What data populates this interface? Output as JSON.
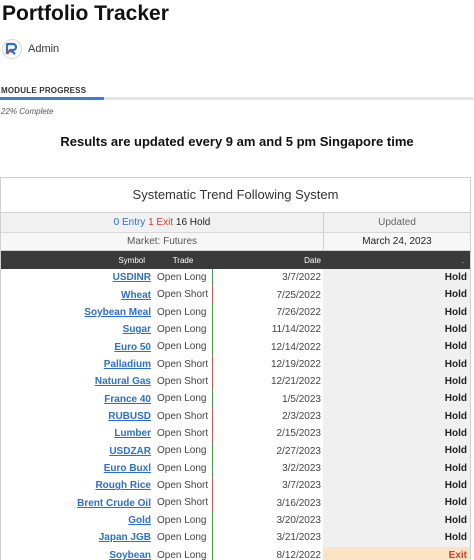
{
  "page": {
    "title": "Portfolio Tracker",
    "author": "Admin",
    "progress_label": "MODULE PROGRESS",
    "progress_percent": 22,
    "progress_text": "22% Complete",
    "headline": "Results are updated every 9 am and 5 pm Singapore time"
  },
  "card": {
    "title": "Systematic Trend Following System",
    "counts": {
      "entry_num": "0",
      "entry_label": " Entry ",
      "exit_num": "1",
      "exit_label": " Exit ",
      "hold": " 16 Hold"
    },
    "updated_label": "Updated",
    "market": "Market: Futures",
    "updated_date": "March 24, 2023"
  },
  "table": {
    "headers": {
      "symbol": "Symbol",
      "trade": "Trade",
      "date": "Date",
      "status": "."
    },
    "rows": [
      {
        "symbol": "USDINR",
        "trade": "Open Long",
        "date": "3/7/2022",
        "status": "Hold"
      },
      {
        "symbol": "Wheat",
        "trade": "Open Short",
        "date": "7/25/2022",
        "status": "Hold"
      },
      {
        "symbol": "Soybean Meal",
        "trade": "Open Long",
        "date": "7/26/2022",
        "status": "Hold"
      },
      {
        "symbol": "Sugar",
        "trade": "Open Long",
        "date": "11/14/2022",
        "status": "Hold"
      },
      {
        "symbol": "Euro 50",
        "trade": "Open Long",
        "date": "12/14/2022",
        "status": "Hold"
      },
      {
        "symbol": "Palladium",
        "trade": "Open Short",
        "date": "12/19/2022",
        "status": "Hold"
      },
      {
        "symbol": "Natural Gas",
        "trade": "Open Short",
        "date": "12/21/2022",
        "status": "Hold"
      },
      {
        "symbol": "France 40",
        "trade": "Open Long",
        "date": "1/5/2023",
        "status": "Hold"
      },
      {
        "symbol": "RUBUSD",
        "trade": "Open Short",
        "date": "2/3/2023",
        "status": "Hold"
      },
      {
        "symbol": "Lumber",
        "trade": "Open Short",
        "date": "2/15/2023",
        "status": "Hold"
      },
      {
        "symbol": "USDZAR",
        "trade": "Open Long",
        "date": "2/27/2023",
        "status": "Hold"
      },
      {
        "symbol": "Euro Buxl",
        "trade": "Open Long",
        "date": "3/2/2023",
        "status": "Hold"
      },
      {
        "symbol": "Rough Rice",
        "trade": "Open Short",
        "date": "3/7/2023",
        "status": "Hold"
      },
      {
        "symbol": "Brent Crude Oil",
        "trade": "Open Short",
        "date": "3/16/2023",
        "status": "Hold"
      },
      {
        "symbol": "Gold",
        "trade": "Open Long",
        "date": "3/20/2023",
        "status": "Hold"
      },
      {
        "symbol": "Japan JGB",
        "trade": "Open Long",
        "date": "3/21/2023",
        "status": "Hold"
      },
      {
        "symbol": "Soybean",
        "trade": "Open Long",
        "date": "8/12/2022",
        "status": "Exit"
      }
    ]
  },
  "colors": {
    "accent": "#3b7dd8",
    "entry": "#2a6fd1",
    "exit": "#d43c2c",
    "long_bar": "#43a047",
    "short_bar": "#d9534f",
    "exit_bg": "#fbe3c4"
  },
  "icons": {
    "avatar": "brand-logo-icon"
  }
}
